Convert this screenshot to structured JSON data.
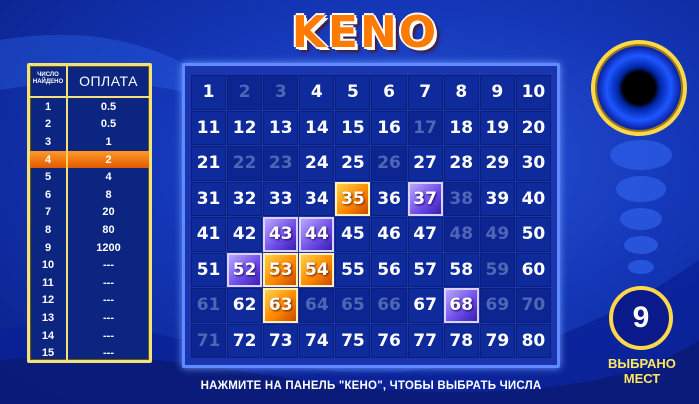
{
  "title": "KENO",
  "paytable": {
    "header_count": "ЧИСЛО НАЙДЕНО",
    "header_pay": "ОПЛАТА",
    "rows": [
      {
        "n": "1",
        "pay": "0.5"
      },
      {
        "n": "2",
        "pay": "0.5"
      },
      {
        "n": "3",
        "pay": "1"
      },
      {
        "n": "4",
        "pay": "2"
      },
      {
        "n": "5",
        "pay": "4"
      },
      {
        "n": "6",
        "pay": "8"
      },
      {
        "n": "7",
        "pay": "20"
      },
      {
        "n": "8",
        "pay": "80"
      },
      {
        "n": "9",
        "pay": "1200"
      },
      {
        "n": "10",
        "pay": "---"
      },
      {
        "n": "11",
        "pay": "---"
      },
      {
        "n": "12",
        "pay": "---"
      },
      {
        "n": "13",
        "pay": "---"
      },
      {
        "n": "14",
        "pay": "---"
      },
      {
        "n": "15",
        "pay": "---"
      }
    ],
    "highlighted_row": "4"
  },
  "board": {
    "numbers_from": 1,
    "numbers_to": 80,
    "dim": [
      2,
      3,
      17,
      22,
      23,
      26,
      38,
      48,
      49,
      59,
      61,
      64,
      65,
      66,
      69,
      70,
      71
    ],
    "gold": [
      35,
      53,
      54,
      63
    ],
    "purple": [
      37,
      43,
      44,
      52,
      68
    ]
  },
  "selected_count": "9",
  "selected_label_line1": "ВЫБРАНО",
  "selected_label_line2": "МЕСТ",
  "instruction": "НАЖМИТЕ НА ПАНЕЛЬ \"КЕНО\", ЧТОБЫ ВЫБРАТЬ ЧИСЛА",
  "colors": {
    "background": "#1437b8",
    "gold_accent": "#ffd84a",
    "orange_highlight": "#ff8a00",
    "purple_highlight": "#6b49e6"
  }
}
